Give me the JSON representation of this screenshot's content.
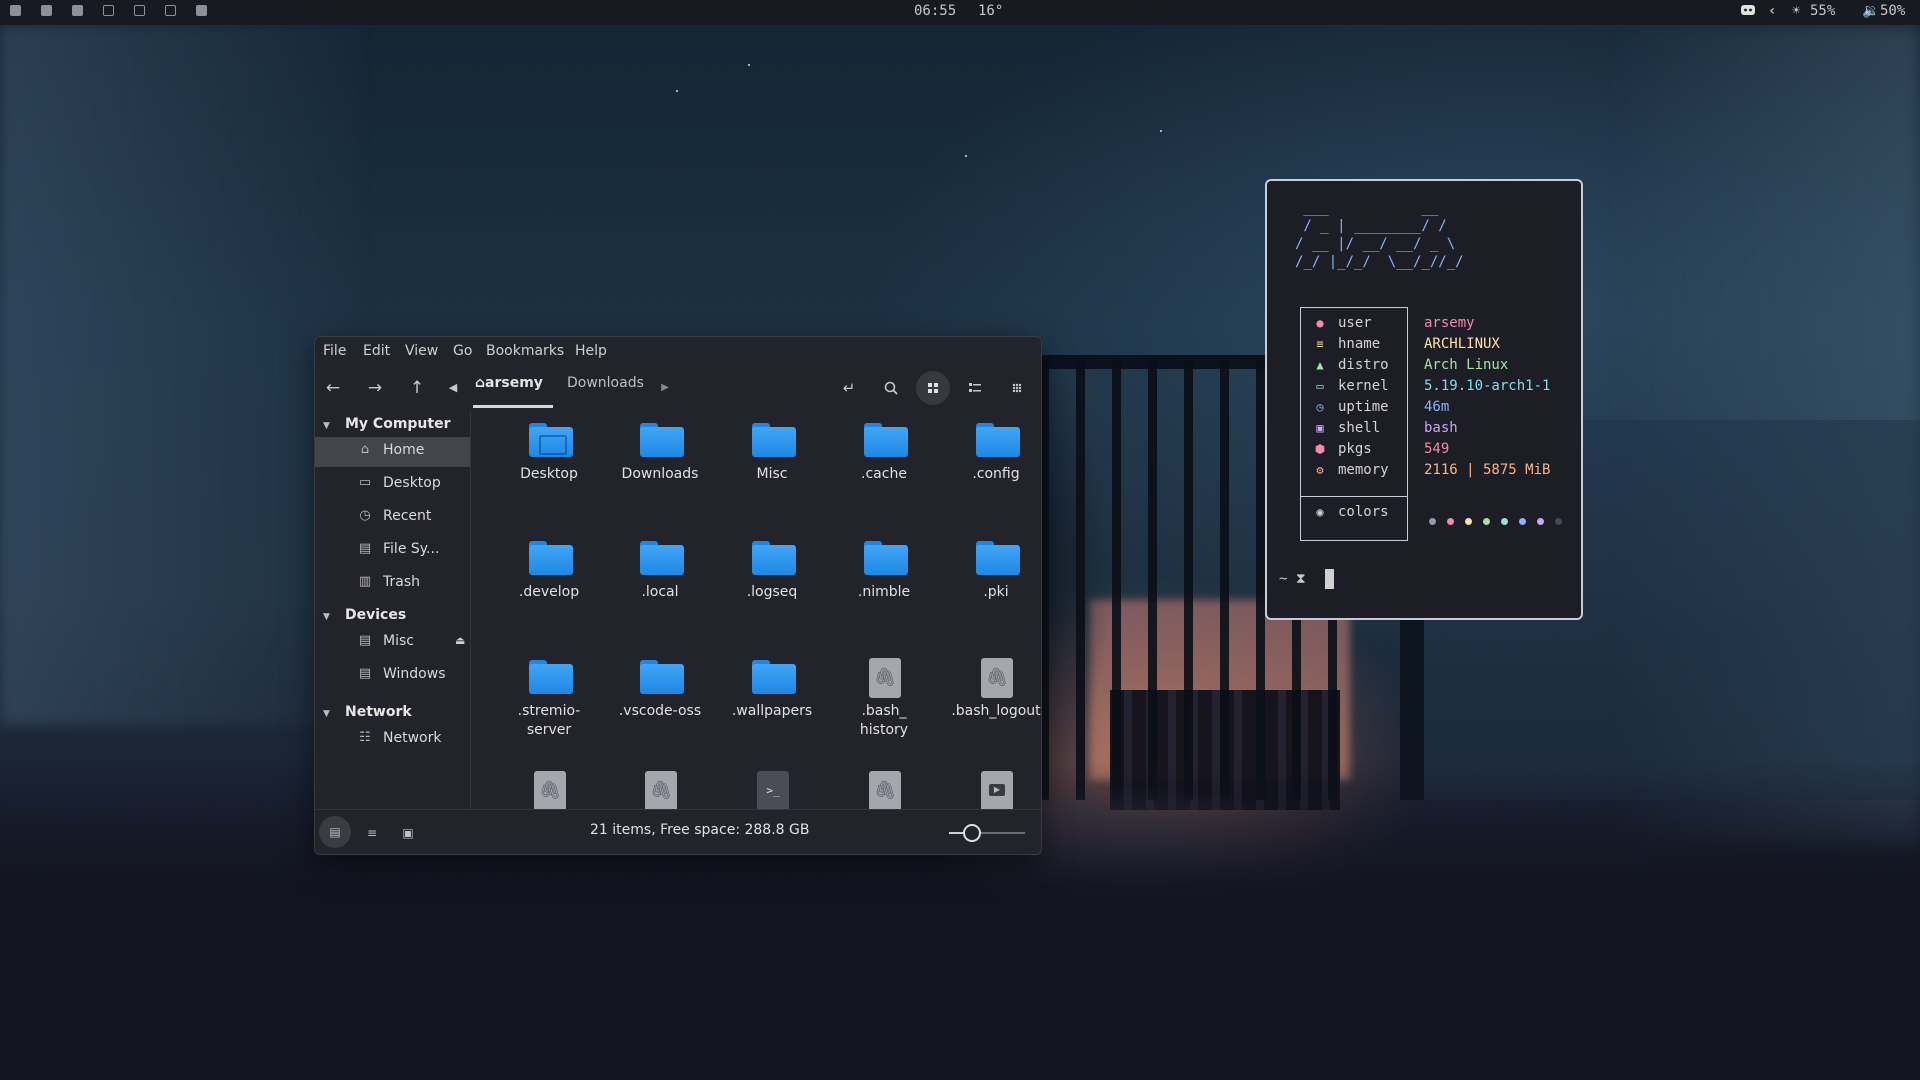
{
  "topbar": {
    "workspaces": [
      {
        "state": "filled"
      },
      {
        "state": "filled"
      },
      {
        "state": "filled"
      },
      {
        "state": "empty"
      },
      {
        "state": "empty"
      },
      {
        "state": "empty"
      },
      {
        "state": "filled"
      }
    ],
    "clock": "06:55",
    "weather": "16°",
    "tray": {
      "discord_icon": "discord-icon",
      "expand_icon": "chevron-left-icon",
      "brightness": "55%",
      "volume": "50%"
    }
  },
  "file_manager": {
    "menu": [
      "File",
      "Edit",
      "View",
      "Go",
      "Bookmarks",
      "Help"
    ],
    "breadcrumb": {
      "home": "arsemy",
      "current": "Downloads"
    },
    "sidebar": {
      "sections": [
        {
          "title": "My Computer",
          "items": [
            {
              "label": "Home",
              "icon": "home-icon",
              "selected": true
            },
            {
              "label": "Desktop",
              "icon": "desktop-icon"
            },
            {
              "label": "Recent",
              "icon": "recent-icon"
            },
            {
              "label": "File Sy...",
              "icon": "drive-icon"
            },
            {
              "label": "Trash",
              "icon": "trash-icon"
            }
          ]
        },
        {
          "title": "Devices",
          "items": [
            {
              "label": "Misc",
              "icon": "drive-icon",
              "eject": true
            },
            {
              "label": "Windows",
              "icon": "drive-icon"
            }
          ]
        },
        {
          "title": "Network",
          "items": [
            {
              "label": "Network",
              "icon": "network-icon"
            }
          ]
        }
      ]
    },
    "items": [
      {
        "name": "Desktop",
        "type": "folder-desktop"
      },
      {
        "name": "Downloads",
        "type": "folder"
      },
      {
        "name": "Misc",
        "type": "folder"
      },
      {
        "name": ".cache",
        "type": "folder"
      },
      {
        "name": ".config",
        "type": "folder"
      },
      {
        "name": ".develop",
        "type": "folder"
      },
      {
        "name": ".local",
        "type": "folder"
      },
      {
        "name": ".logseq",
        "type": "folder"
      },
      {
        "name": ".nimble",
        "type": "folder"
      },
      {
        "name": ".pki",
        "type": "folder"
      },
      {
        "name": ".stremio-server",
        "type": "folder"
      },
      {
        "name": ".vscode-oss",
        "type": "folder"
      },
      {
        "name": ".wallpapers",
        "type": "folder"
      },
      {
        "name": ".bash_history",
        "type": "file"
      },
      {
        "name": ".bash_logout",
        "type": "file"
      },
      {
        "name": "",
        "type": "file"
      },
      {
        "name": "",
        "type": "file"
      },
      {
        "name": "",
        "type": "terminal"
      },
      {
        "name": "",
        "type": "file"
      },
      {
        "name": "",
        "type": "video"
      }
    ],
    "item_labels_display": [
      "Desktop",
      "Downloads",
      "Misc",
      ".cache",
      ".config",
      ".develop",
      ".local",
      ".logseq",
      ".nimble",
      ".pki",
      ".stremio-\nserver",
      ".vscode-oss",
      ".wallpapers",
      ".bash_\nhistory",
      ".bash_logout"
    ],
    "status": "21 items, Free space: 288.8 GB",
    "zoom_level": 0.3
  },
  "terminal": {
    "ascii_logo": " ___           __\n / _ | ________/ /\n/ __ |/ __/ __/ _ \\\n/_/ |_/_/  \\__/_//_/",
    "info": [
      {
        "key": "user",
        "value": "arsemy",
        "icon": "user-icon",
        "color": "#f38ba8"
      },
      {
        "key": "hname",
        "value": "ARCHLINUX",
        "icon": "hostname-icon",
        "color": "#f9e2af"
      },
      {
        "key": "distro",
        "value": "Arch Linux",
        "icon": "distro-icon",
        "color": "#a6e3a1"
      },
      {
        "key": "kernel",
        "value": "5.19.10-arch1-1",
        "icon": "kernel-icon",
        "color": "#89dceb"
      },
      {
        "key": "uptime",
        "value": "46m",
        "icon": "clock-icon",
        "color": "#89b4fa"
      },
      {
        "key": "shell",
        "value": "bash",
        "icon": "shell-icon",
        "color": "#cba6f7"
      },
      {
        "key": "pkgs",
        "value": "549",
        "icon": "package-icon",
        "color": "#f38ba8"
      },
      {
        "key": "memory",
        "value": "2116 | 5875 MiB",
        "icon": "memory-icon",
        "color": "#fab387"
      },
      {
        "key": "colors",
        "value": "",
        "icon": "palette-icon",
        "color": "#d4d4d4"
      }
    ],
    "palette": [
      "#9399b2",
      "#f38ba8",
      "#f9e2af",
      "#a6e3a1",
      "#94e2d5",
      "#89b4fa",
      "#cba6f7",
      "#45475a"
    ],
    "prompt": "~ ⧗"
  }
}
